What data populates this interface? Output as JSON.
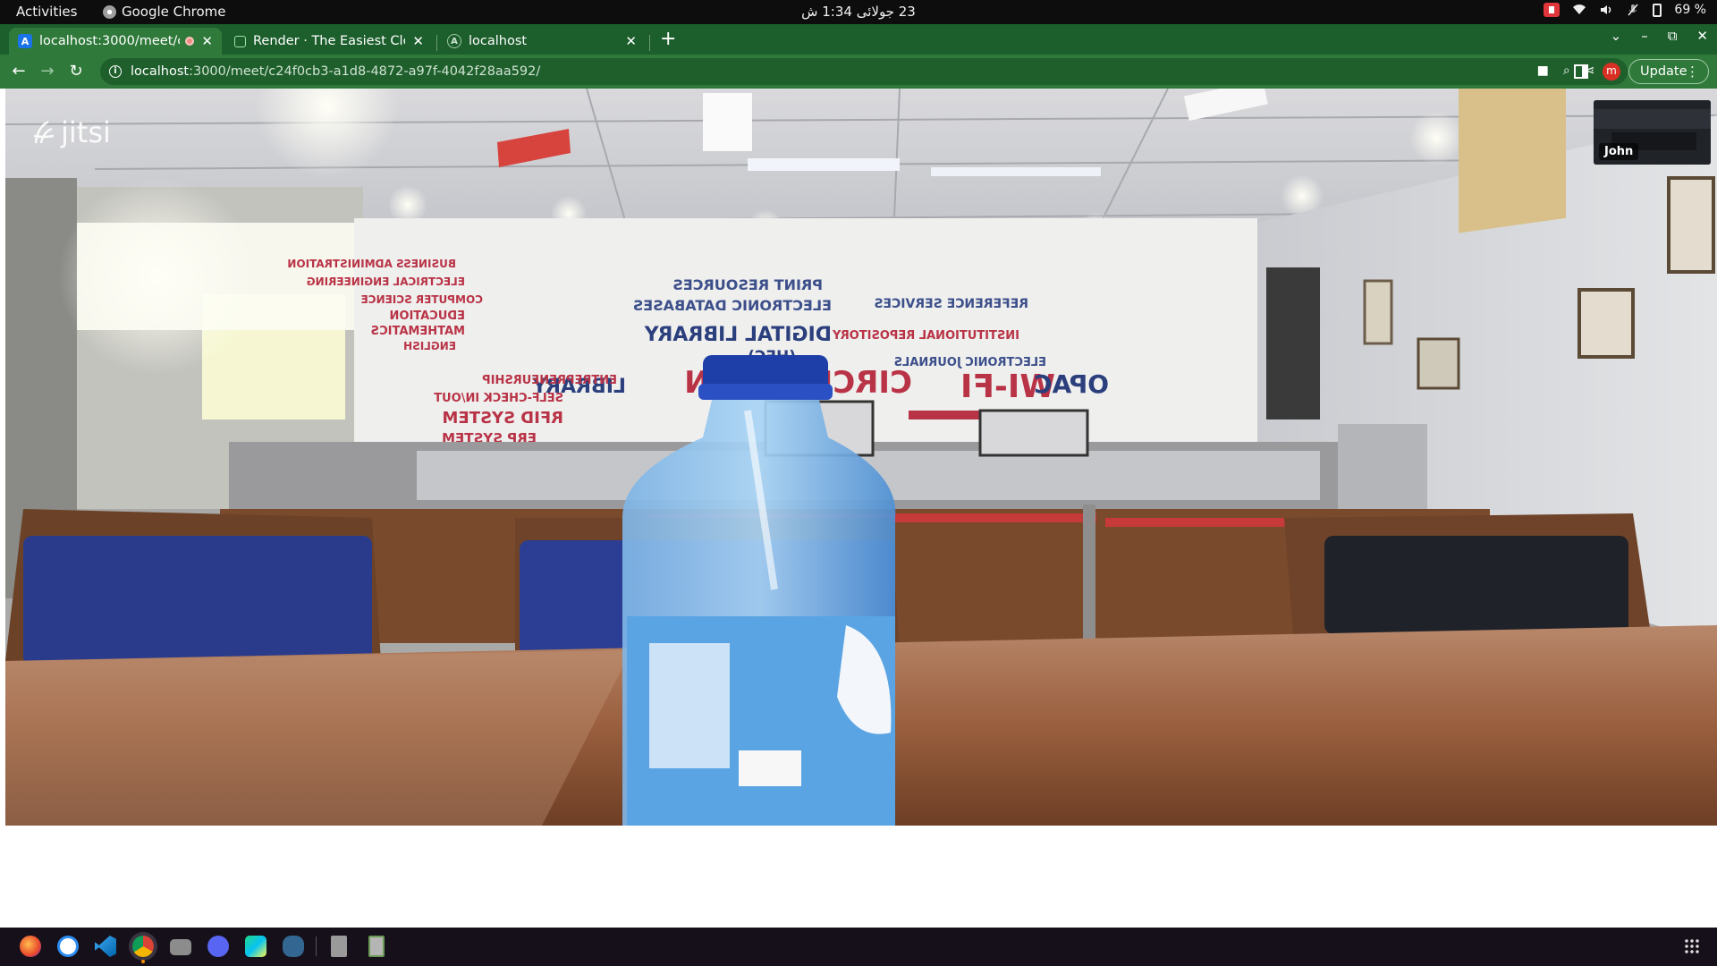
{
  "topbar": {
    "activities": "Activities",
    "app_name": "Google Chrome",
    "clock": "23 جولائی 1:34 ش",
    "battery": "69 %",
    "icons": [
      "screen-record-icon",
      "wifi-icon",
      "volume-icon",
      "mic-muted-icon",
      "battery-icon"
    ]
  },
  "tabs": [
    {
      "title": "localhost:3000/meet/c",
      "favicon": "jitsi-favicon-icon",
      "favicon_letter": "A",
      "active": true,
      "recording": true
    },
    {
      "title": "Render · The Easiest Clou",
      "favicon": "render-favicon-icon",
      "active": false
    },
    {
      "title": "localhost",
      "favicon": "localhost-favicon-icon",
      "favicon_letter": "A",
      "active": false
    }
  ],
  "toolbar": {
    "url_host": "localhost",
    "url_path": ":3000/meet/c24f0cb3-a1d8-4872-a97f-4042f28aa592/",
    "profile_letter": "m",
    "update_label": "Update"
  },
  "meeting": {
    "logo_text": "jitsi",
    "thumbnail_name": "John"
  },
  "dock": {
    "apps": [
      "firefox-icon",
      "app-store-icon",
      "vscode-icon",
      "chrome-icon",
      "files-icon",
      "discord-icon",
      "webstorm-icon",
      "postgres-icon",
      "document-icon",
      "trash-icon"
    ]
  },
  "colors": {
    "chrome_frame": "#1c5e2c",
    "chrome_toolbar": "#2f7a3b",
    "topbar": "#0d0d0d",
    "dock": "#16101a"
  }
}
